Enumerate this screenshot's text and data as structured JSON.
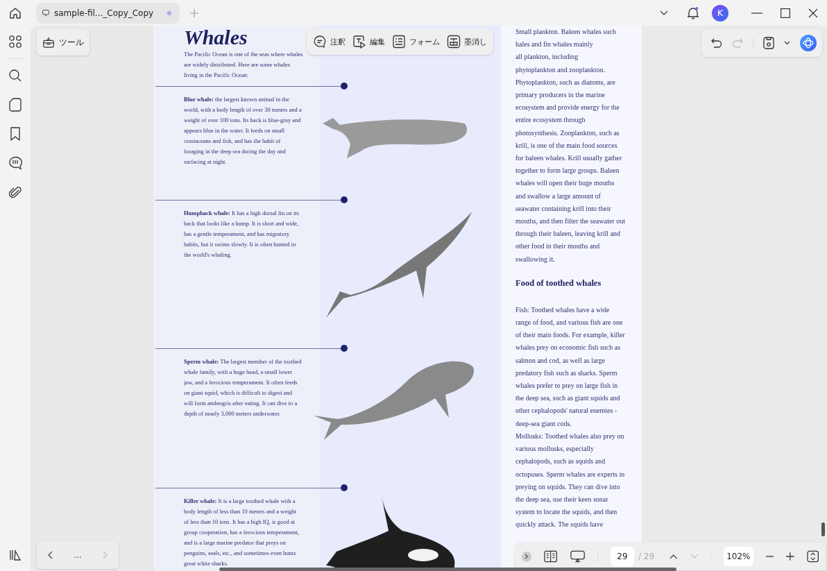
{
  "tab": {
    "title": "sample-fil..._Copy_Copy",
    "unsaved": true
  },
  "user": {
    "initial": "K"
  },
  "tools_button": "ツール",
  "toolbar": [
    {
      "label": "注釈",
      "kind": "comment"
    },
    {
      "label": "編集",
      "kind": "edit"
    },
    {
      "label": "フォーム",
      "kind": "form"
    },
    {
      "label": "墨消し",
      "kind": "redact"
    }
  ],
  "history": {
    "redo_disabled": true
  },
  "page": {
    "title": "Whales",
    "intro": "The Pacific Ocean is one of the seas where whales are widely distributed. Here are some whales living in the Pacific Ocean:",
    "whales": [
      {
        "kind": "blue",
        "text": "**Blue whale:** the largest known animal in the world, with a body length of over 30 meters and a weight of over 100 tons. Its back is blue-gray and appears blue in the water. It feeds on small crustaceans and fish, and has the habit of foraging in the deep sea during the day and surfacing at night."
      },
      {
        "kind": "humpback",
        "text": "**Humpback whale:** It has a high dorsal fin on its back that looks like a hump. It is short and wide, has a gentle temperament, and has migratory habits, but it swims slowly. It is often hunted in the world's whaling."
      },
      {
        "kind": "sperm",
        "text": "**Sperm whale:** The largest member of the toothed whale family, with a huge head, a small lower jaw, and a ferocious temperament. It often feeds on giant squid, which is difficult to digest and will form ambergris after eating. It can dive to a depth of nearly 3,000 meters underwater."
      },
      {
        "kind": "killer",
        "text": "**Killer whale:** It is a large toothed whale with a body length of less than 10 meters and a weight of less than 10 tons. It has a high IQ, is good at group cooperation, has a ferocious temperament, and is a large marine predator that preys on penguins, seals, etc., and sometimes even hunts great white sharks."
      }
    ],
    "right_fragments": [
      "Small plankton. Baleen whales such",
      "hales and fin whales mainly",
      "all plankton, including"
    ],
    "right_paragraph": "phytoplankton and zooplankton. Phytoplankton, such as diatoms, are primary producers in the marine ecosystem and provide energy for the entire ecosystem through photosynthesis. Zooplankton, such as krill, is one of the main food sources for baleen whales. Krill usually gather together to form large groups. Baleen whales will open their huge mouths and swallow a large amount of seawater containing krill into their mouths, and then filter the seawater out through their baleen, leaving krill and other food in their mouths and swallowing it.",
    "heading": "Food of toothed whales",
    "paragraphs": [
      "Fish: Toothed whales have a wide range of food, and various fish are one of their main foods. For example, killer whales prey on economic fish such as salmon and cod, as well as large predatory fish such as sharks. Sperm whales prefer to prey on large fish in the deep sea, such as giant squids and other cephalopods' natural enemies - deep-sea giant cods.",
      "Mollusks: Toothed whales also prey on various mollusks, especially cephalopods, such as squids and octopuses. Sperm whales are experts in preying on squids. They can dive into the deep sea, use their keen sonar system to locate the squids, and then quickly attack. The squids have"
    ]
  },
  "nav": {
    "prev_disabled": false,
    "next_disabled": true,
    "more": "..."
  },
  "pager": {
    "current": "29",
    "total": "/ 29",
    "up_disabled": false,
    "down_disabled": true,
    "zoom": "102%"
  }
}
